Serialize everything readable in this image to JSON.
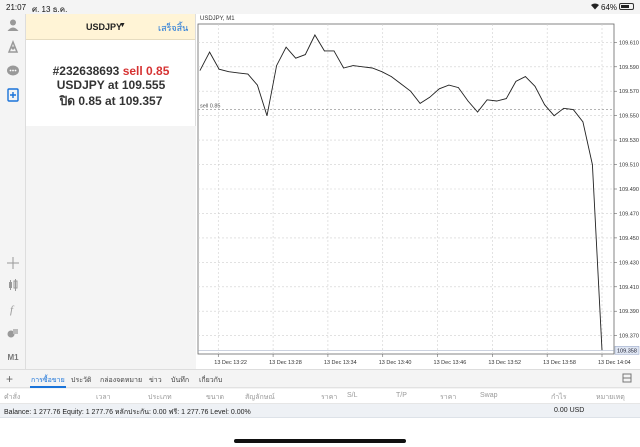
{
  "status_bar": {
    "time": "21:07",
    "date": "ศ. 13 ธ.ค.",
    "battery": "64%"
  },
  "toolbar": {
    "items": [
      "account-icon",
      "signal-icon",
      "chat-icon",
      "new-order-icon",
      "crosshair-icon",
      "chart-type-icon",
      "indicator-icon",
      "objects-icon",
      "timeframe"
    ],
    "timeframe": "M1"
  },
  "order_panel": {
    "symbol": "USDJPY",
    "done": "เสร็จสิ้น",
    "ticket": "#232638693",
    "sell_label": "sell 0.85",
    "open_line": "USDJPY at 109.555",
    "close_line": "ปิด 0.85 at 109.357"
  },
  "chart": {
    "title": "USDJPY, M1",
    "sell_line_label": "sell 0.85",
    "last_price": "109.358"
  },
  "chart_data": {
    "type": "line",
    "title": "USDJPY, M1",
    "xlabel": "",
    "ylabel": "",
    "x_ticks": [
      "13 Dec 13:22",
      "13 Dec 13:28",
      "13 Dec 13:34",
      "13 Dec 13:40",
      "13 Dec 13:46",
      "13 Dec 13:52",
      "13 Dec 13:58",
      "13 Dec 14:04"
    ],
    "y_ticks": [
      109.61,
      109.59,
      109.57,
      109.55,
      109.53,
      109.51,
      109.49,
      109.47,
      109.45,
      109.43,
      109.41,
      109.39,
      109.37
    ],
    "ylim": [
      109.355,
      109.625
    ],
    "grid": true,
    "series": [
      {
        "values": [
          109.587,
          109.602,
          109.588,
          109.586,
          109.585,
          109.584,
          109.575,
          109.55,
          109.591,
          109.606,
          109.597,
          109.6,
          109.616,
          109.603,
          109.603,
          109.589,
          109.591,
          109.59,
          109.589,
          109.586,
          109.582,
          109.576,
          109.57,
          109.56,
          109.565,
          109.572,
          109.575,
          109.573,
          109.562,
          109.553,
          109.563,
          109.562,
          109.564,
          109.578,
          109.582,
          109.574,
          109.559,
          109.55,
          109.556,
          109.555,
          109.545,
          109.51,
          109.358
        ]
      }
    ],
    "reference_lines": [
      {
        "label": "sell 0.85",
        "value": 109.555
      }
    ],
    "last_value": 109.358
  },
  "tabs": {
    "add": "+",
    "items": [
      "การซื้อขาย",
      "ประวัติ",
      "กล่องจดหมาย",
      "ข่าว",
      "บันทึก",
      "เกี่ยวกับ"
    ]
  },
  "table": {
    "headers": [
      "คำสั่ง",
      "เวลา",
      "ประเภท",
      "ขนาด",
      "สัญลักษณ์",
      "ราคา",
      "S/L",
      "T/P",
      "ราคา",
      "Swap",
      "กำไร",
      "หมายเหตุ"
    ]
  },
  "balance": {
    "text": "Balance: 1 277.76  Equity: 1 277.76  หลักประกัน: 0.00  ฟรี: 1 277.76  Level: 0.00%",
    "profit": "0.00  USD"
  }
}
